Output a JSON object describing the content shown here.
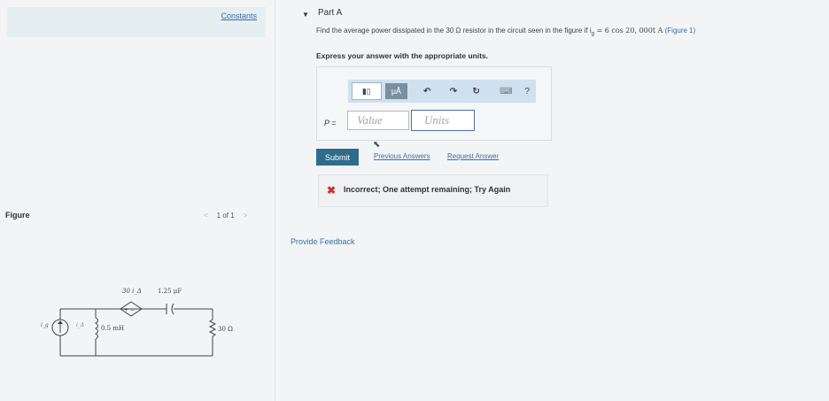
{
  "left": {
    "constants_link": "Constants",
    "figure_label": "Figure",
    "figure_nav": {
      "prev": "<",
      "page_indicator": "1 of 1",
      "next": ">"
    },
    "circuit": {
      "source_label": "i_g",
      "delta_current": "i_Δ",
      "dependent_source": "30 i_Δ",
      "capacitor": "1.25 μF",
      "inductor": "0.5 mH",
      "resistor": "30 Ω"
    }
  },
  "part": {
    "caret": "▼",
    "title": "Part A",
    "question": "Find the average power dissipated in the 30 Ω resistor in the circuit seen in the figure if i",
    "question_sub": "g",
    "question_tail": " = 6 cos 20, 000t A",
    "figure_ref": "(Figure 1)",
    "instruction": "Express your answer with the appropriate units."
  },
  "answer": {
    "toolbar": {
      "templates_icon": "▮▯",
      "units_button": "μÅ",
      "undo_icon": "↶",
      "redo_icon": "↷",
      "reset_icon": "↻",
      "keyboard_icon": "⌨",
      "help_icon": "?"
    },
    "variable_label": "P =",
    "value_placeholder": "Value",
    "units_placeholder": "Units"
  },
  "actions": {
    "submit": "Submit",
    "previous_answers": "Previous Answers",
    "request_answer": "Request Answer"
  },
  "feedback": {
    "icon": "✖",
    "message": "Incorrect; One attempt remaining; Try Again"
  },
  "provide_feedback": "Provide Feedback",
  "colors": {
    "accent": "#2f6c8c",
    "link": "#3a6fa8",
    "error": "#d0302a",
    "toolbar": "#cfe1ef"
  }
}
